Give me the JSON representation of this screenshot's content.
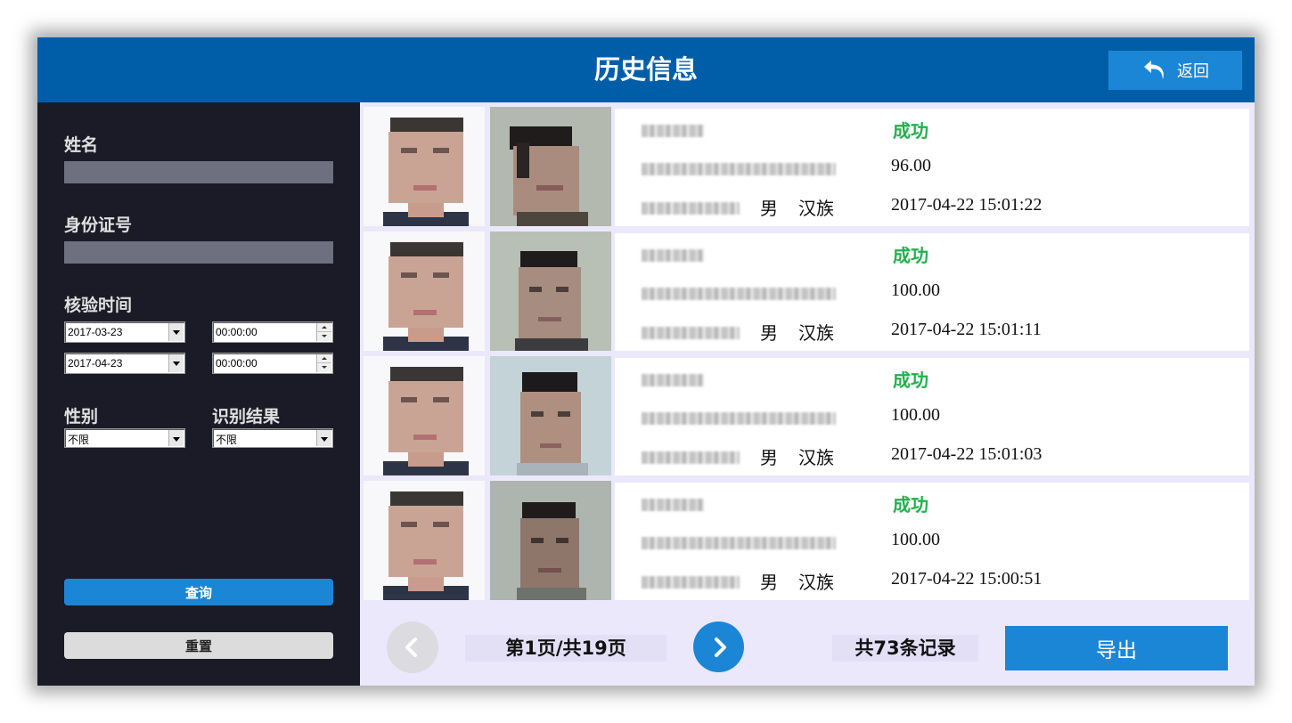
{
  "header": {
    "title": "历史信息",
    "back_label": "返回"
  },
  "filters": {
    "name_label": "姓名",
    "name_value": "",
    "id_label": "身份证号",
    "id_value": "",
    "time_label": "核验时间",
    "start_date": "2017-03-23",
    "start_time": "00:00:00",
    "end_date": "2017-04-23",
    "end_time": "00:00:00",
    "gender_label": "性别",
    "gender_value": "不限",
    "result_label": "识别结果",
    "result_value": "不限",
    "query_label": "查询",
    "reset_label": "重置"
  },
  "records": [
    {
      "gender": "男",
      "ethnicity": "汉族",
      "result": "成功",
      "score": "96.00",
      "time": "2017-04-22 15:01:22"
    },
    {
      "gender": "男",
      "ethnicity": "汉族",
      "result": "成功",
      "score": "100.00",
      "time": "2017-04-22 15:01:11"
    },
    {
      "gender": "男",
      "ethnicity": "汉族",
      "result": "成功",
      "score": "100.00",
      "time": "2017-04-22 15:01:03"
    },
    {
      "gender": "男",
      "ethnicity": "汉族",
      "result": "成功",
      "score": "100.00",
      "time": "2017-04-22 15:00:51"
    }
  ],
  "pagination": {
    "page_info": "第1页/共19页",
    "total_info": "共73条记录",
    "export_label": "导出"
  },
  "icons": {
    "back": "undo-arrow-icon",
    "prev": "chevron-left-icon",
    "next": "chevron-right-icon"
  },
  "colors": {
    "header": "#005ea8",
    "accent": "#1c86d6",
    "success": "#23b14d",
    "sidebar": "#1a1b26",
    "list_bg": "#ebe8fb"
  }
}
